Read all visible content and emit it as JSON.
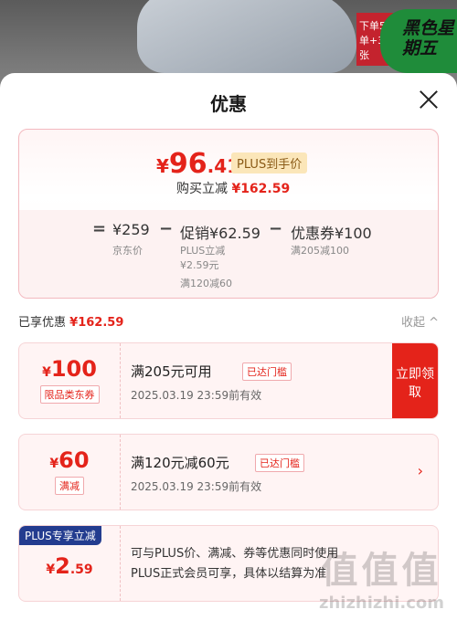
{
  "background": {
    "badge": "黑色星期五",
    "promo_tag": "下单5单+3张"
  },
  "sheet": {
    "title": "优惠"
  },
  "summary": {
    "price_yen": "¥",
    "price_int": "96",
    "price_dec": ".41",
    "plus_tag": "PLUS到手价",
    "buy_label": "购买立减",
    "buy_amount": "¥162.59",
    "eq": "=",
    "minus": "−",
    "items": [
      {
        "value": "¥259",
        "sub": "京东价"
      },
      {
        "value": "促销¥62.59",
        "sub1": "PLUS立减",
        "sub2": "¥2.59元",
        "sub3": "满120减60"
      },
      {
        "value": "优惠券¥100",
        "sub": "满205减100"
      }
    ]
  },
  "enjoyed": {
    "label": "已享优惠",
    "amount": "¥162.59",
    "collapse": "收起 ^"
  },
  "coupons": [
    {
      "yen": "¥",
      "value": "100",
      "tag": "限品类东券",
      "title": "满205元可用",
      "status": "已达门槛",
      "expire": "2025.03.19 23:59前有效",
      "action": "立即领取"
    },
    {
      "yen": "¥",
      "value": "60",
      "tag": "满减",
      "title": "满120元减60元",
      "status": "已达门槛",
      "expire": "2025.03.19 23:59前有效",
      "action": "›"
    },
    {
      "badge": "PLUS专享立减",
      "yen": "¥",
      "value": "2",
      "dec": ".59",
      "line1": "可与PLUS价、满减、券等优惠同时使用",
      "line2": "PLUS正式会员可享，具体以结算为准"
    }
  ],
  "watermark": {
    "big": "值值值",
    "small": "zhizhizhi.com"
  }
}
